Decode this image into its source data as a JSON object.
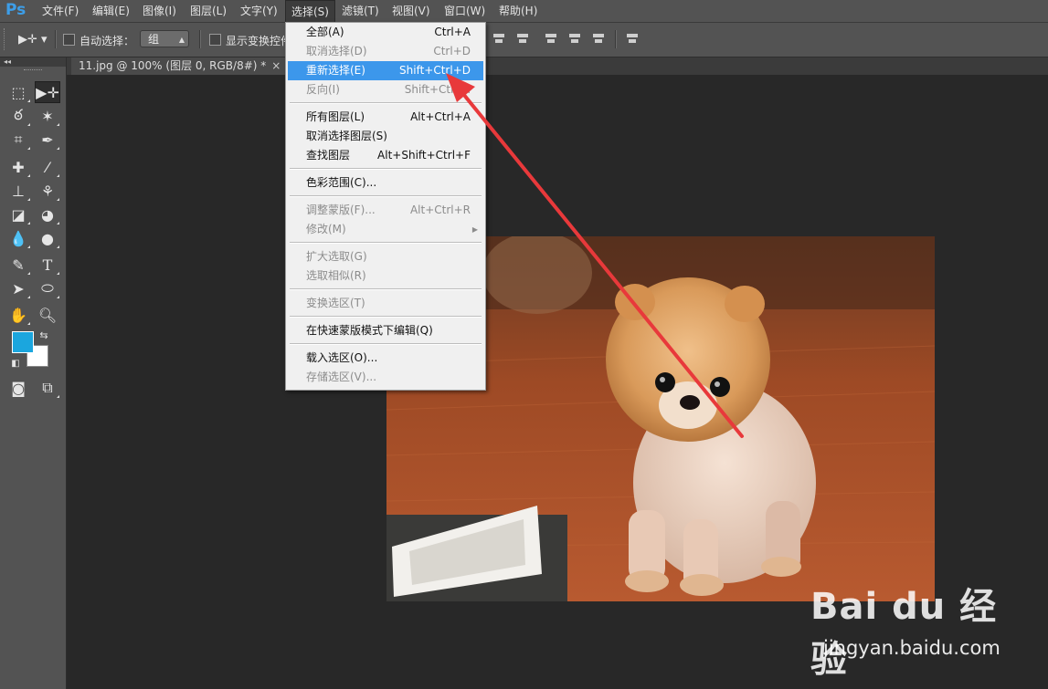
{
  "app": {
    "logo": "Ps"
  },
  "menubar": {
    "items": [
      "文件(F)",
      "编辑(E)",
      "图像(I)",
      "图层(L)",
      "文字(Y)",
      "选择(S)",
      "滤镜(T)",
      "视图(V)",
      "窗口(W)",
      "帮助(H)"
    ],
    "active": "选择(S)"
  },
  "options": {
    "auto_select_label": "自动选择：",
    "auto_select_value": "组",
    "show_transform_label": "显示变换控件"
  },
  "document": {
    "tab_title": "11.jpg @ 100% (图层 0, RGB/8#) *",
    "close": "×"
  },
  "colors": {
    "foreground": "#1ba6de",
    "background": "#ffffff",
    "highlight": "#3c97eb",
    "arrow": "#e8393b"
  },
  "select_menu": {
    "items": [
      {
        "label": "全部(A)",
        "shortcut": "Ctrl+A",
        "enabled": true
      },
      {
        "label": "取消选择(D)",
        "shortcut": "Ctrl+D",
        "enabled": false
      },
      {
        "label": "重新选择(E)",
        "shortcut": "Shift+Ctrl+D",
        "enabled": true,
        "highlighted": true
      },
      {
        "label": "反向(I)",
        "shortcut": "Shift+Ctrl+I",
        "enabled": false
      },
      {
        "label": "所有图层(L)",
        "shortcut": "Alt+Ctrl+A",
        "enabled": true
      },
      {
        "label": "取消选择图层(S)",
        "shortcut": "",
        "enabled": true
      },
      {
        "label": "查找图层",
        "shortcut": "Alt+Shift+Ctrl+F",
        "enabled": true
      },
      {
        "label": "色彩范围(C)...",
        "shortcut": "",
        "enabled": true
      },
      {
        "label": "调整蒙版(F)...",
        "shortcut": "Alt+Ctrl+R",
        "enabled": false
      },
      {
        "label": "修改(M)",
        "shortcut": "",
        "enabled": false,
        "submenu": true
      },
      {
        "label": "扩大选取(G)",
        "shortcut": "",
        "enabled": false
      },
      {
        "label": "选取相似(R)",
        "shortcut": "",
        "enabled": false
      },
      {
        "label": "变换选区(T)",
        "shortcut": "",
        "enabled": false
      },
      {
        "label": "在快速蒙版模式下编辑(Q)",
        "shortcut": "",
        "enabled": true
      },
      {
        "label": "载入选区(O)...",
        "shortcut": "",
        "enabled": true
      },
      {
        "label": "存储选区(V)...",
        "shortcut": "",
        "enabled": false
      }
    ]
  },
  "tools": [
    "marquee-icon",
    "move-icon",
    "lasso-icon",
    "magic-wand-icon",
    "crop-icon",
    "eyedropper-icon",
    "healing-brush-icon",
    "brush-icon",
    "clone-stamp-icon",
    "history-brush-icon",
    "eraser-icon",
    "paint-bucket-icon",
    "blur-icon",
    "dodge-icon",
    "pen-icon",
    "type-icon",
    "path-selection-icon",
    "ellipse-icon",
    "hand-icon",
    "zoom-icon"
  ],
  "tool_type_glyph": "T",
  "watermark": {
    "brand": "Bai du 经验",
    "url": "jingyan.baidu.com"
  }
}
